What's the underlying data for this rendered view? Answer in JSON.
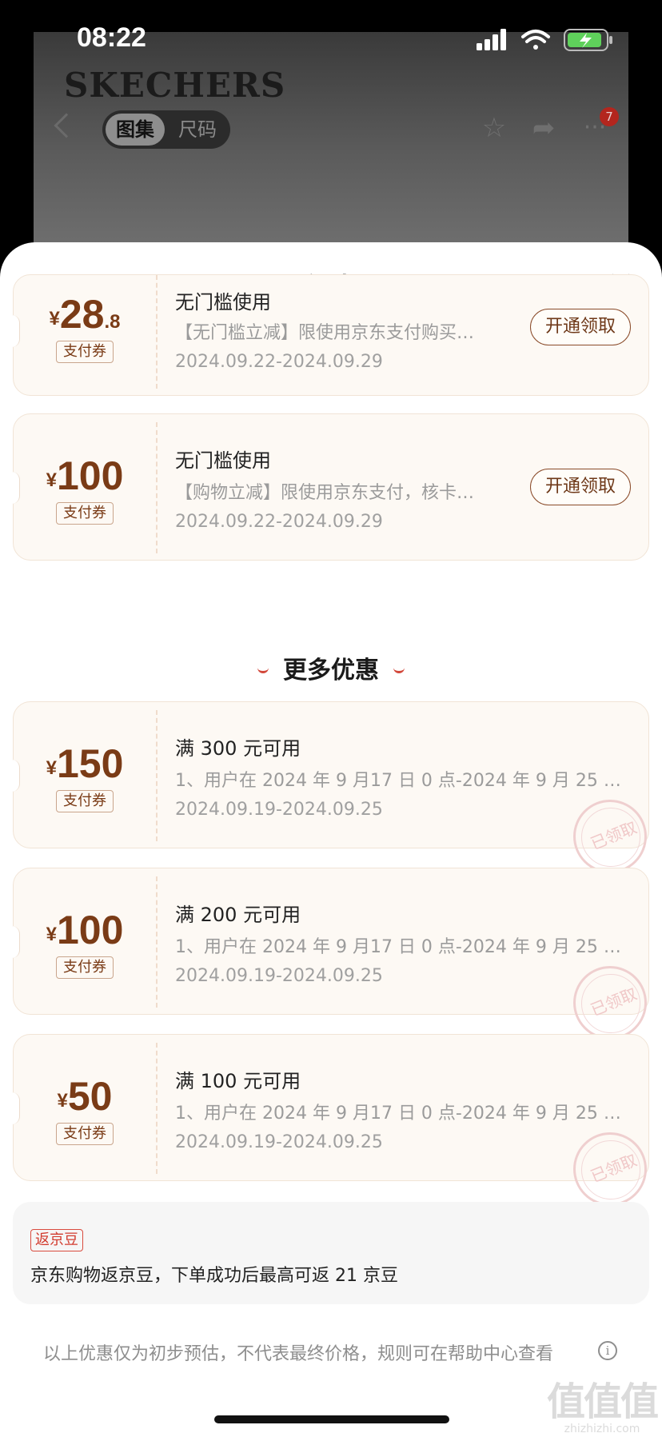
{
  "status_bar": {
    "time": "08:22"
  },
  "background_page": {
    "brand": "SKECHERS",
    "segment_tabs": [
      "图集",
      "尺码"
    ],
    "cart_badge": "7"
  },
  "sheet": {
    "title": "优惠",
    "coupons": [
      {
        "currency": "¥",
        "amount_int": "28",
        "amount_dec": ".8",
        "tag": "支付券",
        "title": "无门槛使用",
        "desc": "【无门槛立减】限使用京东支付购买…",
        "dates": "2024.09.22-2024.09.29",
        "button": "开通领取"
      },
      {
        "currency": "¥",
        "amount_int": "100",
        "amount_dec": "",
        "tag": "支付券",
        "title": "无门槛使用",
        "desc": "【购物立减】限使用京东支付，核卡…",
        "dates": "2024.09.22-2024.09.29",
        "button": "开通领取"
      }
    ],
    "more_title": "更多优惠",
    "more_coupons": [
      {
        "currency": "¥",
        "amount": "150",
        "tag": "支付券",
        "title": "满 300 元可用",
        "desc": "1、用户在 2024 年 9 月17 日 0 点-2024 年 9 月 25 日2…",
        "dates": "2024.09.19-2024.09.25",
        "stamp": "已领取"
      },
      {
        "currency": "¥",
        "amount": "100",
        "tag": "支付券",
        "title": "满 200 元可用",
        "desc": "1、用户在 2024 年 9 月17 日 0 点-2024 年 9 月 25 日2…",
        "dates": "2024.09.19-2024.09.25",
        "stamp": "已领取"
      },
      {
        "currency": "¥",
        "amount": "50",
        "tag": "支付券",
        "title": "满 100 元可用",
        "desc": "1、用户在 2024 年 9 月17 日 0 点-2024 年 9 月 25 日2…",
        "dates": "2024.09.19-2024.09.25",
        "stamp": "已领取"
      }
    ],
    "jingdou": {
      "tag": "返京豆",
      "text": "京东购物返京豆，下单成功后最高可返 21 京豆"
    },
    "footer_note": "以上优惠仅为初步预估，不代表最终价格，规则可在帮助中心查看"
  },
  "watermark": {
    "big": "值值值",
    "small": "zhizhizhi.com"
  },
  "colors": {
    "accent": "#7a3b16",
    "red": "#d23b2e",
    "coupon_bg": "#fdf9f4"
  }
}
